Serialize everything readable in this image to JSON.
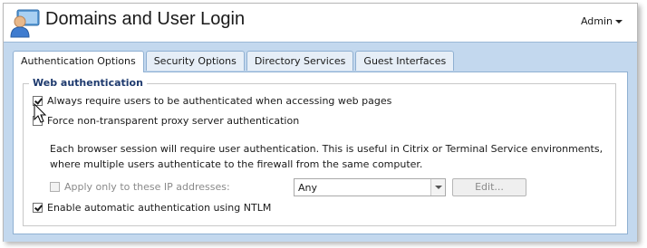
{
  "header": {
    "title": "Domains and User Login",
    "user_menu": "Admin",
    "app_icon": "users-login-icon"
  },
  "tabs": [
    {
      "label": "Authentication Options",
      "active": true
    },
    {
      "label": "Security Options",
      "active": false
    },
    {
      "label": "Directory Services",
      "active": false
    },
    {
      "label": "Guest Interfaces",
      "active": false
    }
  ],
  "web_auth": {
    "legend": "Web authentication",
    "always_require": {
      "label": "Always require users to be authenticated when accessing web pages",
      "checked": true
    },
    "force_proxy": {
      "label": "Force non-transparent proxy server authentication",
      "checked": false
    },
    "description": "Each browser session will require user authentication. This is useful in Citrix or Terminal Service environments, where multiple users authenticate to the firewall from the same computer.",
    "apply_only": {
      "label": "Apply only to these IP addresses:",
      "checked": false,
      "disabled": true
    },
    "ip_select": {
      "value": "Any"
    },
    "edit_button": "Edit...",
    "ntlm": {
      "label": "Enable automatic authentication using NTLM",
      "checked": true
    }
  },
  "colors": {
    "content_bg": "#c3d8ee",
    "legend_text": "#1e3a6e"
  }
}
